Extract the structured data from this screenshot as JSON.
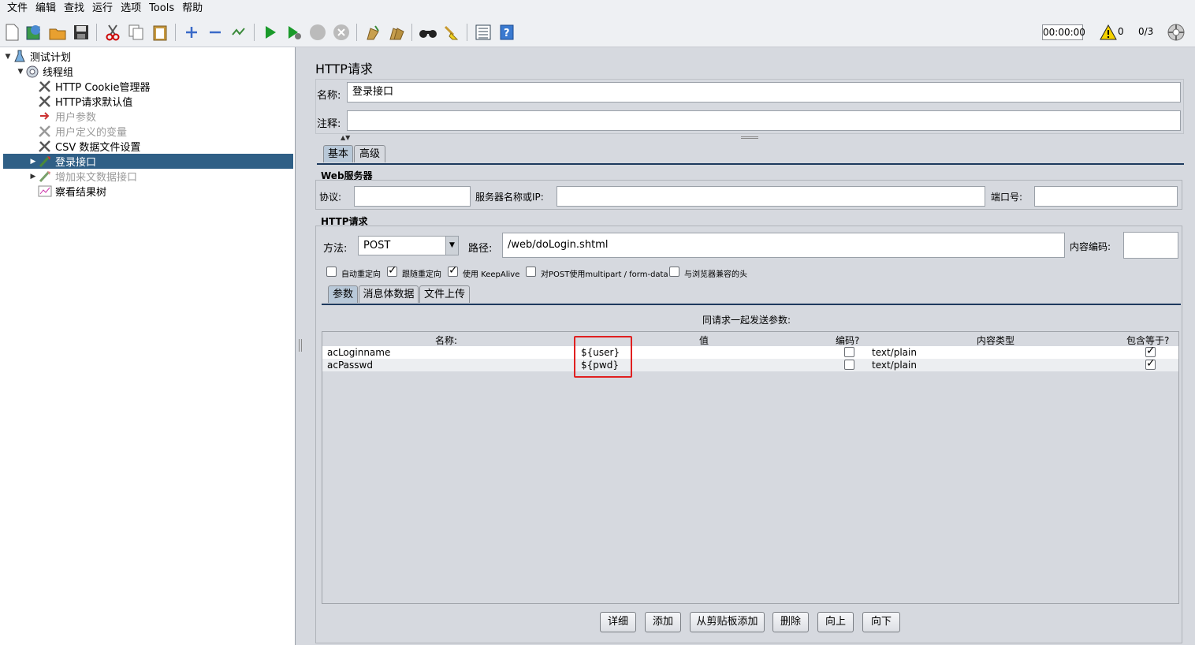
{
  "menu": [
    "文件",
    "编辑",
    "查找",
    "运行",
    "选项",
    "Tools",
    "帮助"
  ],
  "toolbar": {
    "timer": "00:00:00",
    "warning_count": "0",
    "threads": "0/3",
    "icons": [
      "new-icon",
      "templates-icon",
      "open-icon",
      "save-icon",
      "cut-icon",
      "copy-icon",
      "paste-icon",
      "expand-icon",
      "collapse-icon",
      "toggle-icon",
      "start-icon",
      "start-no-pause-icon",
      "stop-icon",
      "shutdown-icon",
      "clear-icon",
      "clear-all-icon",
      "search-icon",
      "reset-search-icon",
      "function-helper-icon",
      "help-icon"
    ]
  },
  "tree": {
    "items": [
      {
        "label": "测试计划",
        "icon": "test-plan-icon"
      },
      {
        "label": "线程组",
        "icon": "thread-group-icon"
      },
      {
        "label": "HTTP Cookie管理器",
        "icon": "config-element-icon"
      },
      {
        "label": "HTTP请求默认值",
        "icon": "config-element-icon"
      },
      {
        "label": "用户参数",
        "icon": "pre-processor-icon"
      },
      {
        "label": "用户定义的变量",
        "icon": "config-element-icon"
      },
      {
        "label": "CSV 数据文件设置",
        "icon": "config-element-icon"
      },
      {
        "label": "登录接口",
        "icon": "sampler-icon"
      },
      {
        "label": "增加来文数据接口",
        "icon": "sampler-icon"
      },
      {
        "label": "察看结果树",
        "icon": "listener-icon"
      }
    ]
  },
  "panel": {
    "title": "HTTP请求",
    "name_label": "名称:",
    "name_value": "登录接口",
    "comment_label": "注释:",
    "comment_value": "",
    "tabs": [
      "基本",
      "高级"
    ],
    "web_server": {
      "title": "Web服务器",
      "protocol_label": "协议:",
      "protocol_value": "",
      "server_label": "服务器名称或IP:",
      "server_value": "",
      "port_label": "端口号:",
      "port_value": ""
    },
    "http_request": {
      "title": "HTTP请求",
      "method_label": "方法:",
      "method_value": "POST",
      "path_label": "路径:",
      "path_value": "/web/doLogin.shtml",
      "encoding_label": "内容编码:",
      "encoding_value": ""
    },
    "options": [
      {
        "label": "自动重定向",
        "checked": false
      },
      {
        "label": "跟随重定向",
        "checked": true
      },
      {
        "label": "使用 KeepAlive",
        "checked": true
      },
      {
        "label": "对POST使用multipart / form-data",
        "checked": false
      },
      {
        "label": "与浏览器兼容的头",
        "checked": false
      }
    ],
    "sub_tabs": [
      "参数",
      "消息体数据",
      "文件上传"
    ],
    "params": {
      "caption": "同请求一起发送参数:",
      "columns": [
        "名称:",
        "值",
        "编码?",
        "内容类型",
        "包含等于?"
      ],
      "rows": [
        {
          "name": "acLoginname",
          "value": "${user}",
          "encode": false,
          "content_type": "text/plain",
          "include_equals": true
        },
        {
          "name": "acPasswd",
          "value": "${pwd}",
          "encode": false,
          "content_type": "text/plain",
          "include_equals": true
        }
      ]
    },
    "buttons": [
      "详细",
      "添加",
      "从剪贴板添加",
      "删除",
      "向上",
      "向下"
    ]
  }
}
